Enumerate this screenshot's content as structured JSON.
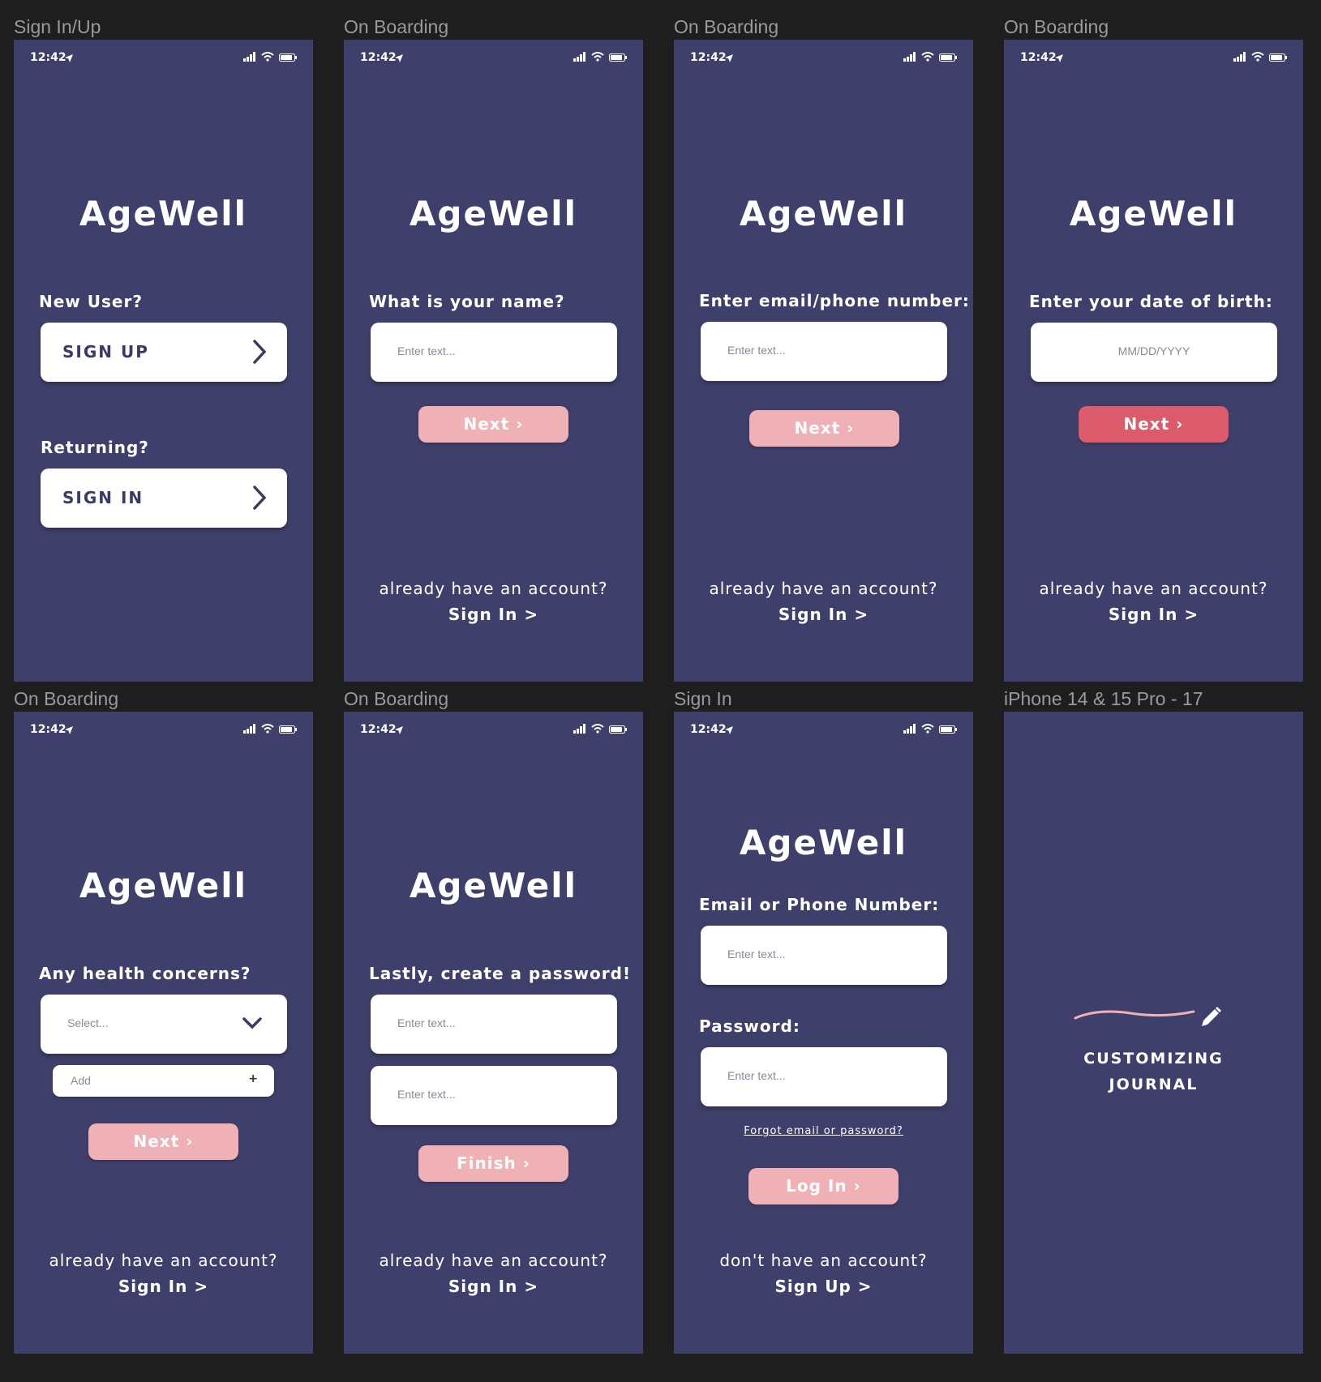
{
  "frames": [
    {
      "label": "Sign In/Up"
    },
    {
      "label": "On Boarding"
    },
    {
      "label": "On Boarding"
    },
    {
      "label": "On Boarding"
    },
    {
      "label": "On Boarding"
    },
    {
      "label": "On Boarding"
    },
    {
      "label": "Sign In"
    },
    {
      "label": "iPhone 14 & 15 Pro - 17"
    }
  ],
  "status": {
    "time": "12:42"
  },
  "app_name": "AgeWell",
  "signinup": {
    "new_user": "New User?",
    "sign_up": "SIGN UP",
    "returning": "Returning?",
    "sign_in": "SIGN IN"
  },
  "name_screen": {
    "prompt": "What is your name?",
    "placeholder": "Enter text...",
    "next": "Next"
  },
  "email_screen": {
    "prompt": "Enter email/phone number:",
    "placeholder": "Enter text...",
    "next": "Next"
  },
  "dob_screen": {
    "prompt": "Enter your date of birth:",
    "placeholder": "MM/DD/YYYY",
    "next": "Next"
  },
  "health_screen": {
    "prompt": "Any health concerns?",
    "select_placeholder": "Select...",
    "add_placeholder": "Add",
    "add_symbol": "+",
    "next": "Next"
  },
  "password_screen": {
    "prompt": "Lastly, create a password!",
    "placeholder1": "Enter text...",
    "placeholder2": "Enter text...",
    "finish": "Finish"
  },
  "account": {
    "question": "already have an account?",
    "link": "Sign In >"
  },
  "signin_screen": {
    "email_label": "Email or Phone Number:",
    "email_placeholder": "Enter text...",
    "password_label": "Password:",
    "password_placeholder": "Enter text...",
    "forgot": "Forgot email or password?",
    "login": "Log In",
    "no_account": "don't have an account?",
    "signup_link": "Sign Up >"
  },
  "journal_screen": {
    "line1": "CUSTOMIZING",
    "line2": "JOURNAL"
  },
  "colors": {
    "background": "#1e1e1e",
    "screen": "#3f3f6b",
    "pill_disabled": "#efb1b5",
    "pill_active": "#dc5b6a",
    "text_dark": "#3a3a66"
  },
  "icons": [
    "location-arrow-icon",
    "signal-icon",
    "wifi-icon",
    "battery-icon",
    "chevron-right-icon",
    "chevron-down-icon",
    "pencil-icon"
  ]
}
